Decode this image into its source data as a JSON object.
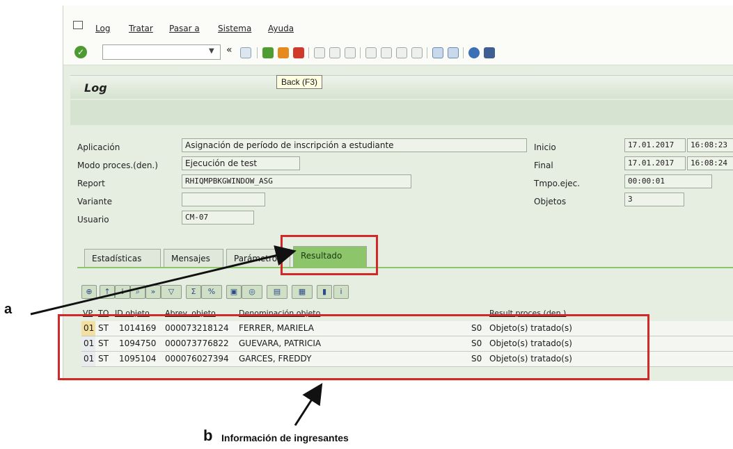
{
  "menu": {
    "items": [
      "Log",
      "Tratar",
      "Pasar a",
      "Sistema",
      "Ayuda"
    ]
  },
  "toolbar": {
    "command_value": "",
    "tooltip": "Back  (F3)"
  },
  "title": "Log",
  "fields": {
    "aplicacion_label": "Aplicación",
    "aplicacion_value": "Asignación de período de inscripción a estudiante",
    "modo_label": "Modo proces.(den.)",
    "modo_value": "Ejecución de test",
    "report_label": "Report",
    "report_value": "RHIQMPBKGWINDOW_ASG",
    "variante_label": "Variante",
    "variante_value": "",
    "usuario_label": "Usuario",
    "usuario_value": "CM-07",
    "inicio_label": "Inicio",
    "inicio_date": "17.01.2017",
    "inicio_time": "16:08:23",
    "final_label": "Final",
    "final_date": "17.01.2017",
    "final_time": "16:08:24",
    "tmpo_label": "Tmpo.ejec.",
    "tmpo_value": "00:00:01",
    "objetos_label": "Objetos",
    "objetos_value": "3"
  },
  "tabs": [
    "Estadísticas",
    "Mensajes",
    "Parámetros",
    "Resultado"
  ],
  "active_tab": "Resultado",
  "table": {
    "headers": [
      "VP",
      "TO",
      "ID objeto",
      "Abrev. objeto",
      "Denominación objeto",
      "Result.proces.(den.)"
    ],
    "rows": [
      [
        "01",
        "ST",
        "1014169",
        "000073218124",
        "FERRER, MARIELA",
        "S0",
        "Objeto(s) tratado(s)"
      ],
      [
        "01",
        "ST",
        "1094750",
        "000073776822",
        "GUEVARA, PATRICIA",
        "S0",
        "Objeto(s) tratado(s)"
      ],
      [
        "01",
        "ST",
        "1095104",
        "000076027394",
        "GARCES, FREDDY",
        "S0",
        "Objeto(s) tratado(s)"
      ]
    ]
  },
  "annotations": {
    "a": "a",
    "b_letter": "b",
    "b_text": "Información de ingresantes"
  },
  "colors": {
    "annotation_red": "#d22828",
    "active_tab": "#8cc56a"
  }
}
